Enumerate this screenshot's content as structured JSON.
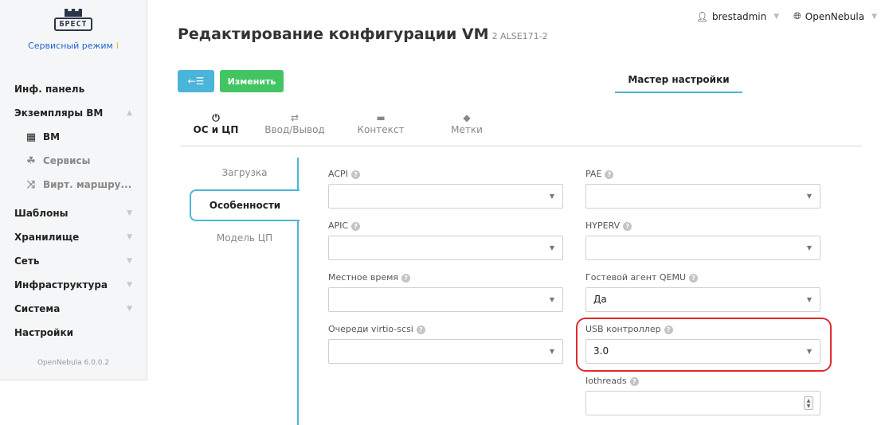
{
  "sidebar": {
    "logo_text": "БРЕСТ",
    "mode_label": "Сервисный режим",
    "mode_info_glyph": "i",
    "menu": {
      "dashboard": "Инф. панель",
      "vm_instances": "Экземпляры ВМ",
      "vms": "ВМ",
      "services": "Сервисы",
      "virtual_routers": "Вирт. маршру...",
      "templates": "Шаблоны",
      "storage": "Хранилище",
      "network": "Сеть",
      "infrastructure": "Инфраструктура",
      "system": "Система",
      "settings": "Настройки"
    },
    "version": "OpenNebula 6.0.0.2"
  },
  "topbar": {
    "user": "brestadmin",
    "zone": "OpenNebula"
  },
  "page": {
    "title": "Редактирование конфигурации VM",
    "subtitle": "2 ALSE171-2"
  },
  "toolbar": {
    "back_label": "←☰",
    "update_label": "Изменить",
    "wizard_label": "Мастер настройки"
  },
  "tabs": {
    "os_cpu": "ОС и ЦП",
    "io": "Ввод/Вывод",
    "context": "Контекст",
    "tags": "Метки"
  },
  "subtabs": {
    "boot": "Загрузка",
    "features": "Особенности",
    "cpu_model": "Модель ЦП"
  },
  "fields": {
    "acpi": {
      "label": "ACPI",
      "value": ""
    },
    "pae": {
      "label": "PAE",
      "value": ""
    },
    "apic": {
      "label": "APIC",
      "value": ""
    },
    "hyperv": {
      "label": "HYPERV",
      "value": ""
    },
    "localtime": {
      "label": "Местное время",
      "value": ""
    },
    "guest_agent": {
      "label": "Гостевой агент QEMU",
      "value": "Да"
    },
    "virtio_scsi": {
      "label": "Очереди virtio-scsi",
      "value": ""
    },
    "usb": {
      "label": "USB контроллер",
      "value": "3.0"
    },
    "iothreads": {
      "label": "Iothreads",
      "value": ""
    }
  },
  "colors": {
    "accent": "#4ab5d9",
    "success": "#43c463",
    "highlight": "#e02a2a"
  }
}
